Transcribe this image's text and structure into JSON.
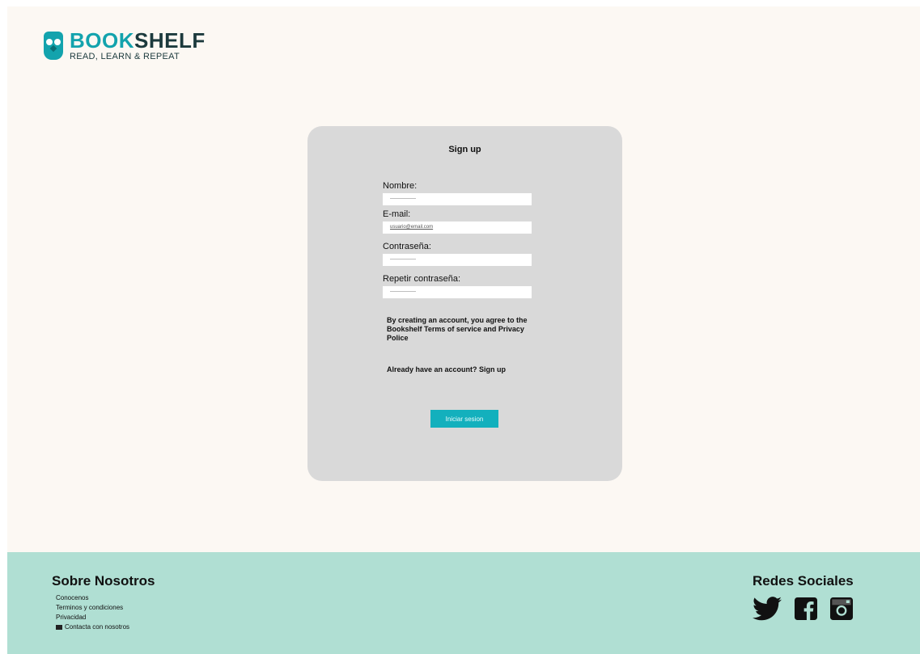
{
  "brand": {
    "name_part1": "BOOK",
    "name_part2": "SHELF",
    "tagline": "READ, LEARN & REPEAT"
  },
  "signup": {
    "title": "Sign up",
    "fields": [
      {
        "label": "Nombre:",
        "value": "----------------"
      },
      {
        "label": "E-mail:",
        "value": "usuario@email.com"
      },
      {
        "label": "Contraseña:",
        "value": "----------------"
      },
      {
        "label": "Repetir contraseña:",
        "value": "----------------"
      }
    ],
    "terms_text": "By creating an account, you agree to the Bookshelf Terms of service and Privacy Police",
    "already_text": "Already have an account? Sign up",
    "submit_label": "Iniciar sesion"
  },
  "footer": {
    "about_title": "Sobre Nosotros",
    "about_links": [
      "Conocenos",
      "Terminos y condiciones",
      "Privacidad",
      "Contacta con nosotros"
    ],
    "social_title": "Redes Sociales",
    "social_icons": [
      "twitter-icon",
      "facebook-icon",
      "instagram-icon"
    ]
  },
  "colors": {
    "accent": "#13b0bd",
    "page_bg": "#fcf8f3",
    "card_bg": "#d9d9d9",
    "footer_bg": "#b0dfd3"
  }
}
